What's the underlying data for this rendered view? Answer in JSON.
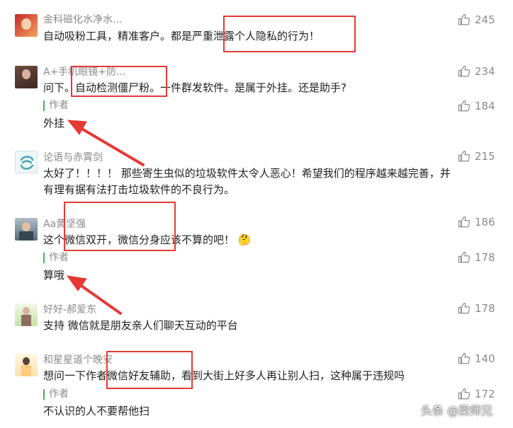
{
  "comments": [
    {
      "name": "金科磁化水净水...",
      "text": "自动吸粉工具，精准客户。都是严重泄露个人隐私的行为！",
      "likes": "245"
    },
    {
      "name": "A+手机眼镜+防...",
      "text": "问下。自动检测僵尸粉。一件群发软件。是属于外挂。还是助手?",
      "likes": "234"
    },
    {
      "author_label": "作者",
      "text": "外挂",
      "likes": "184"
    },
    {
      "name": "论语与赤霄剑",
      "text_line1": "太好了！！！！ 那些寄生虫似的垃圾软件太令人恶心！希望我们的程序越来越完善，并",
      "text_line2": "有理有据有法打击垃圾软件的不良行为。",
      "likes": "215"
    },
    {
      "name": "Aa黄坚强",
      "text": "这个微信双开，微信分身应该不算的吧！",
      "emoji": "🤔",
      "likes": "186"
    },
    {
      "author_label": "作者",
      "text": "算哦",
      "likes": "178"
    },
    {
      "name": "好好-郝爱东",
      "text": "支持 微信就是朋友亲人们聊天互动的平台",
      "likes": "178"
    },
    {
      "name": "和星星道个晚安",
      "text": "想问一下作者微信好友辅助，看到大街上好多人再让别人扫，这种属于违规吗",
      "likes": "140"
    },
    {
      "author_label": "作者",
      "text": "不认识的人不要帮他扫",
      "likes": "172"
    }
  ],
  "watermark": "头条 @梁师兄",
  "colors": {
    "annotation": "#e53935",
    "author_bar": "#4cb050",
    "name": "#8a8a8a"
  }
}
